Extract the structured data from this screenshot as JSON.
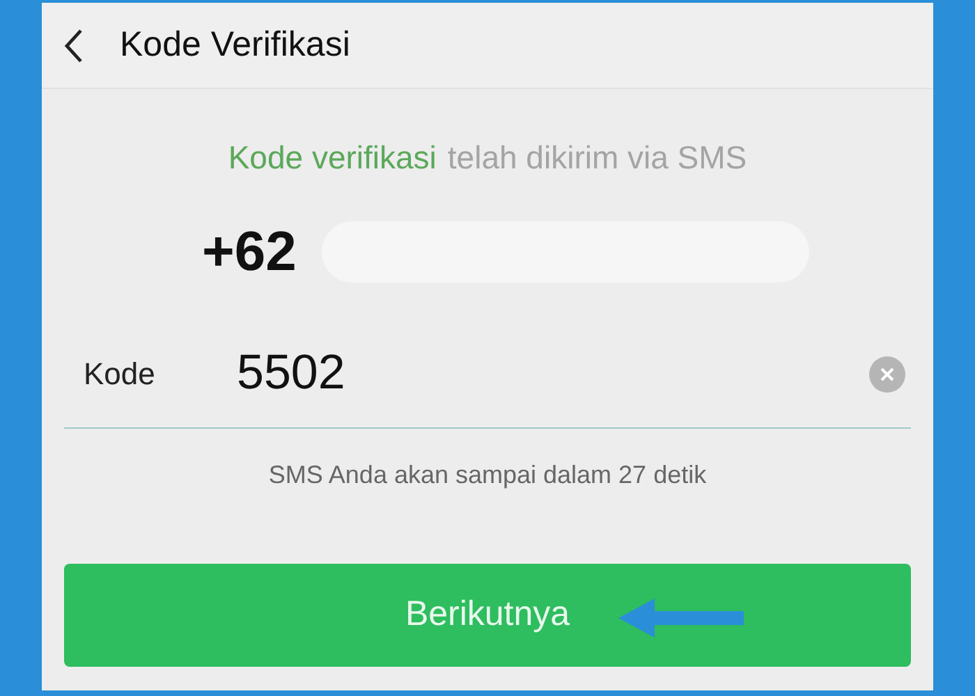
{
  "header": {
    "title": "Kode Verifikasi"
  },
  "message": {
    "highlight": "Kode verifikasi",
    "rest": "telah dikirim via SMS"
  },
  "phone": {
    "prefix": "+62"
  },
  "code_field": {
    "label": "Kode",
    "value": "5502"
  },
  "countdown": "SMS Anda akan sampai dalam 27 detik",
  "next_button": {
    "label": "Berikutnya"
  }
}
